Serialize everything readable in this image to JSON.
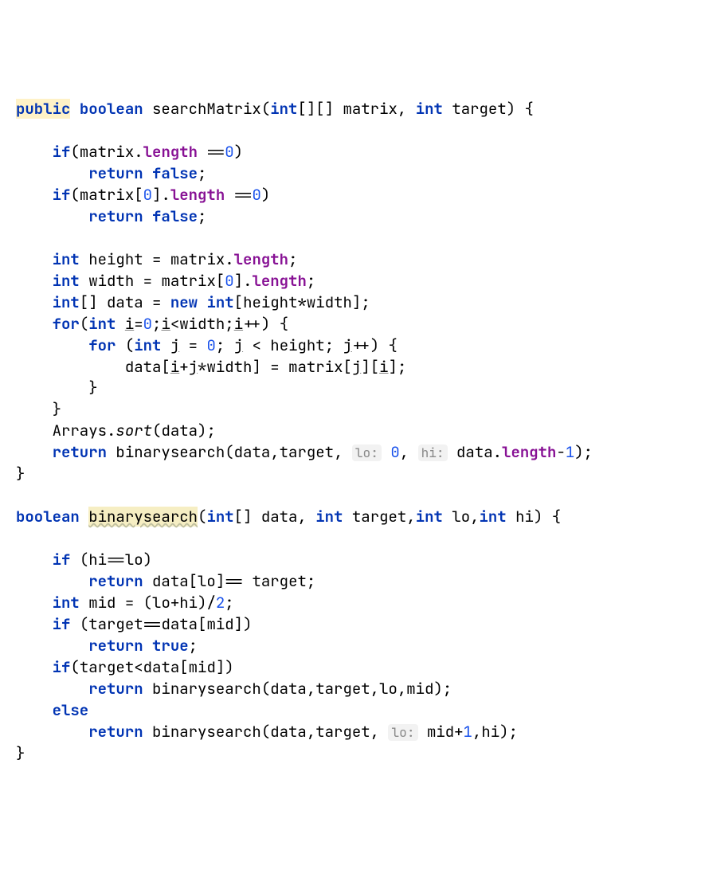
{
  "tokens": {
    "public": "public",
    "boolean": "boolean",
    "int": "int",
    "return": "return",
    "false": "false",
    "true": "true",
    "if": "if",
    "for": "for",
    "new": "new",
    "else": "else",
    "length": "length",
    "sort": "sort"
  },
  "idents": {
    "searchMatrix": "searchMatrix",
    "matrix": "matrix",
    "target": "target",
    "height": "height",
    "width": "width",
    "data": "data",
    "i": "i",
    "j": "j",
    "Arrays": "Arrays",
    "binarysearch": "binarysearch",
    "lo": "lo",
    "hi": "hi",
    "mid": "mid"
  },
  "hints": {
    "lo": "lo:",
    "hi": "hi:"
  },
  "nums": {
    "zero": "0",
    "one": "1",
    "two": "2"
  },
  "punct": {
    "lparen": "(",
    "rparen": ")",
    "lbrace": "{",
    "rbrace": "}",
    "lbrack": "[",
    "rbrack": "]",
    "semi": ";",
    "comma": ",",
    "dot": ".",
    "eq": "=",
    "eqeq": "==",
    "lt": "<",
    "plus": "+",
    "plusplus": "++",
    "star": "*",
    "minus": "-",
    "slash": "/"
  }
}
